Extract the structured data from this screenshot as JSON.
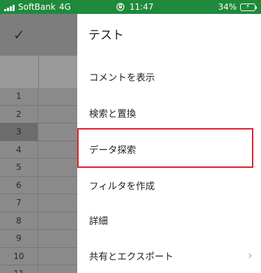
{
  "status_bar": {
    "carrier": "SoftBank",
    "network": "4G",
    "time": "11:47",
    "battery": "34%",
    "bar_color": "#1f8a3b",
    "icons": [
      "signal-icon",
      "rotation-lock-icon",
      "battery-charging-icon"
    ]
  },
  "sheet": {
    "confirm_icon": "checkmark-icon",
    "row_numbers": [
      "1",
      "2",
      "3",
      "4",
      "5",
      "6",
      "7",
      "8",
      "9",
      "10",
      "11"
    ],
    "selected_row": "3"
  },
  "menu": {
    "title": "テスト",
    "items": [
      {
        "label": "コメントを表示"
      },
      {
        "label": "検索と置換"
      },
      {
        "label": "データ探索"
      },
      {
        "label": "フィルタを作成"
      },
      {
        "label": "詳細"
      },
      {
        "label": "共有とエクスポート"
      }
    ],
    "highlight_color": "#e0202a"
  }
}
